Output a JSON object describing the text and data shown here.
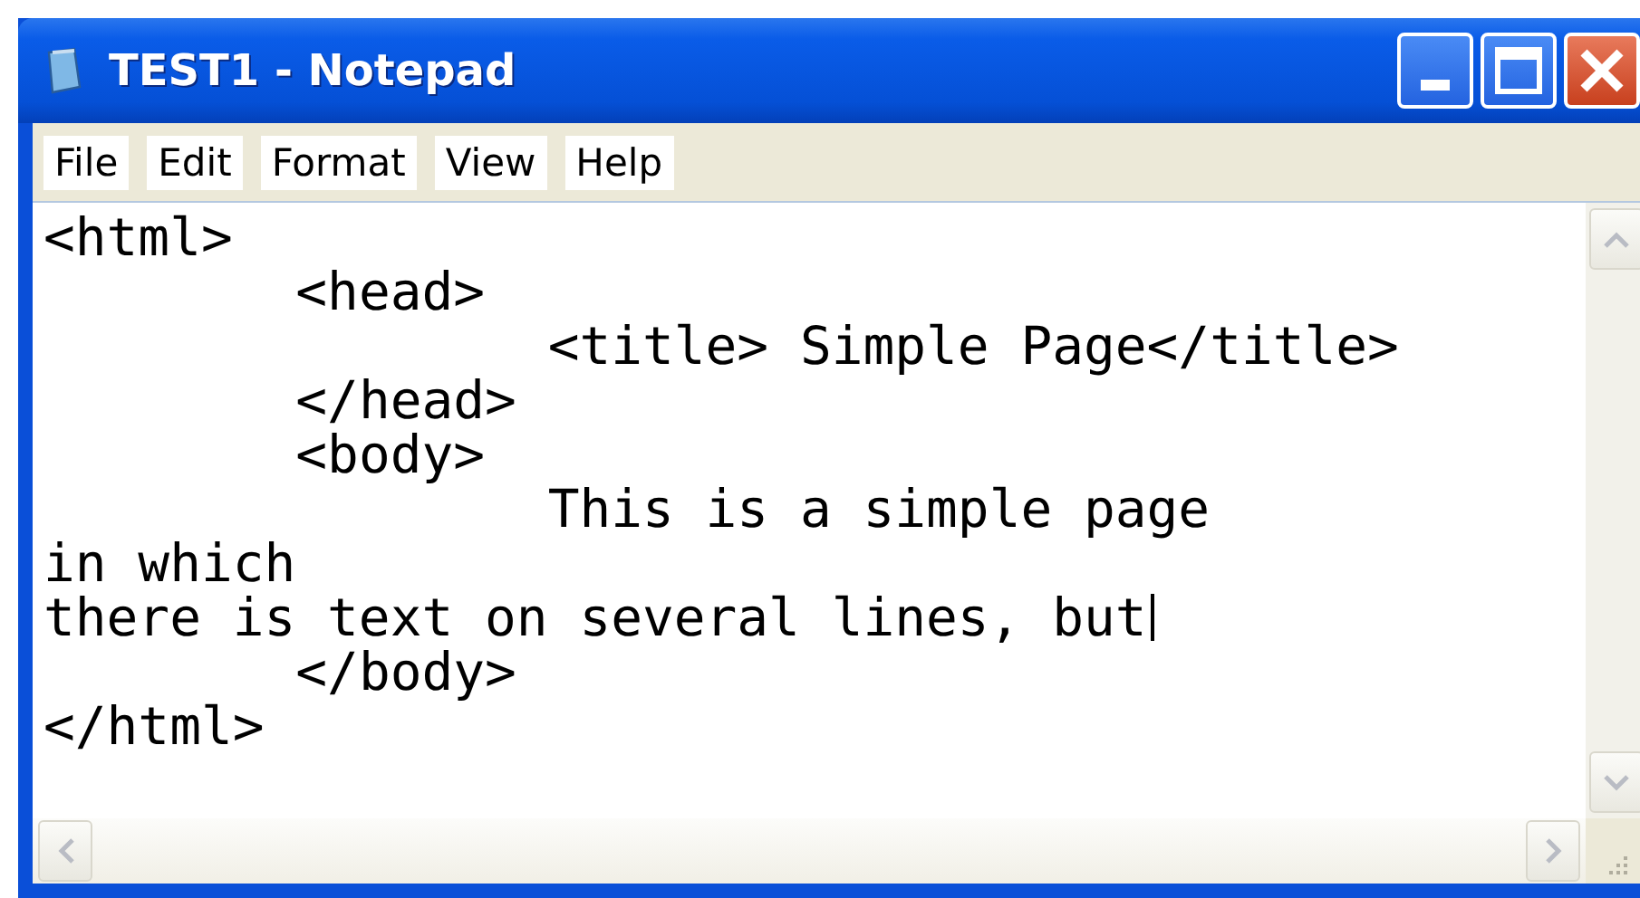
{
  "window": {
    "title": "TEST1 - Notepad"
  },
  "menu": [
    "File",
    "Edit",
    "Format",
    "View",
    "Help"
  ],
  "editor": {
    "lines": [
      {
        "text": "<html>",
        "caret": false
      },
      {
        "text": "\t<head>",
        "caret": false
      },
      {
        "text": "\t\t<title> Simple Page</title>",
        "caret": false
      },
      {
        "text": "\t</head>",
        "caret": false
      },
      {
        "text": "\t<body>",
        "caret": false
      },
      {
        "text": "\t\tThis is a simple page",
        "caret": false
      },
      {
        "text": "in which",
        "caret": false
      },
      {
        "text": "there is text on several lines, but",
        "caret": true
      },
      {
        "text": "\t</body>",
        "caret": false
      },
      {
        "text": "</html>",
        "caret": false
      }
    ]
  }
}
